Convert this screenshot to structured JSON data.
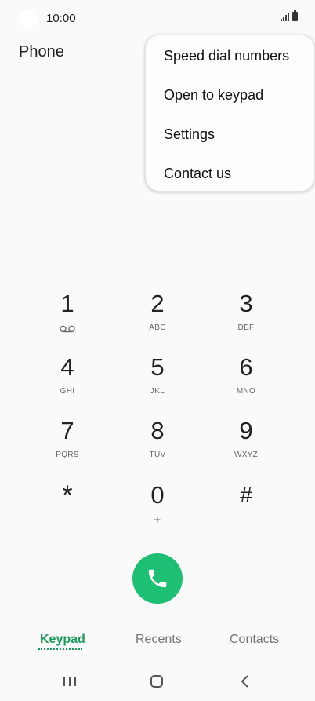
{
  "status": {
    "time": "10:00",
    "icons": [
      "signal-icon",
      "battery-icon"
    ]
  },
  "app": {
    "title": "Phone"
  },
  "menu": {
    "items": [
      {
        "label": "Speed dial numbers"
      },
      {
        "label": "Open to keypad"
      },
      {
        "label": "Settings"
      },
      {
        "label": "Contact us"
      }
    ]
  },
  "keypad": {
    "keys": [
      {
        "digit": "1",
        "letters": "",
        "icon": "voicemail-icon"
      },
      {
        "digit": "2",
        "letters": "ABC"
      },
      {
        "digit": "3",
        "letters": "DEF"
      },
      {
        "digit": "4",
        "letters": "GHI"
      },
      {
        "digit": "5",
        "letters": "JKL"
      },
      {
        "digit": "6",
        "letters": "MNO"
      },
      {
        "digit": "7",
        "letters": "PQRS"
      },
      {
        "digit": "8",
        "letters": "TUV"
      },
      {
        "digit": "9",
        "letters": "WXYZ"
      },
      {
        "digit": "*",
        "letters": ""
      },
      {
        "digit": "0",
        "letters": "+"
      },
      {
        "digit": "#",
        "letters": ""
      }
    ]
  },
  "call": {
    "icon": "phone-icon",
    "color": "#1dbf73"
  },
  "tabs": [
    {
      "label": "Keypad",
      "active": true
    },
    {
      "label": "Recents",
      "active": false
    },
    {
      "label": "Contacts",
      "active": false
    }
  ],
  "navbar": {
    "icons": [
      "recent-apps-icon",
      "home-icon",
      "back-icon"
    ]
  },
  "colors": {
    "accent": "#1a9a5b",
    "call_green": "#1dbf73",
    "background": "#fafafa"
  }
}
